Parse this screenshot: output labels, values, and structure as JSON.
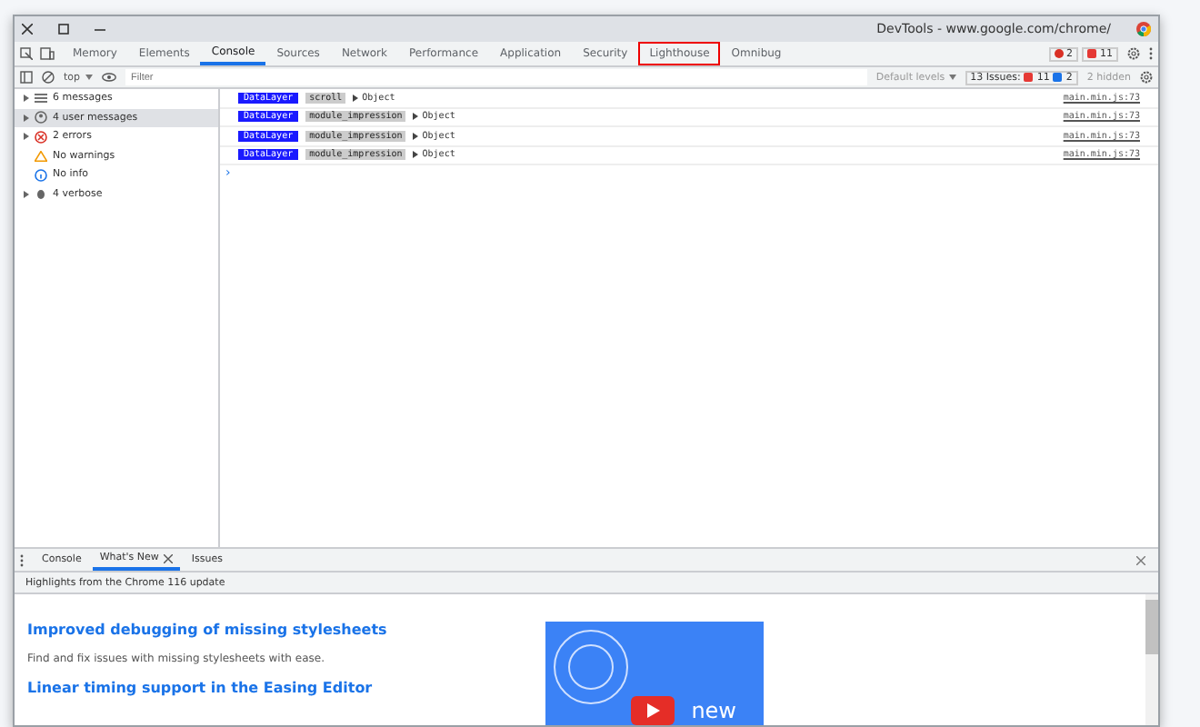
{
  "window": {
    "title": "DevTools - www.google.com/chrome/"
  },
  "tabs": [
    {
      "label": "Memory",
      "selected": false,
      "highlighted": false
    },
    {
      "label": "Elements",
      "selected": false,
      "highlighted": false
    },
    {
      "label": "Console",
      "selected": true,
      "highlighted": false
    },
    {
      "label": "Sources",
      "selected": false,
      "highlighted": false
    },
    {
      "label": "Network",
      "selected": false,
      "highlighted": false
    },
    {
      "label": "Performance",
      "selected": false,
      "highlighted": false
    },
    {
      "label": "Application",
      "selected": false,
      "highlighted": false
    },
    {
      "label": "Security",
      "selected": false,
      "highlighted": false
    },
    {
      "label": "Lighthouse",
      "selected": false,
      "highlighted": true
    },
    {
      "label": "Omnibug",
      "selected": false,
      "highlighted": false
    }
  ],
  "tab_badges": {
    "errors": "2",
    "issues": "11"
  },
  "toolbar": {
    "context": "top",
    "filter_placeholder": "Filter",
    "levels": "Default levels",
    "issues_label": "13 Issues:",
    "issues_errors": "11",
    "issues_info": "2",
    "hidden": "2 hidden"
  },
  "sidebar": {
    "items": [
      {
        "kind": "list",
        "label": "6 messages",
        "expandable": true,
        "selected": false
      },
      {
        "kind": "user",
        "label": "4 user messages",
        "expandable": true,
        "selected": true
      },
      {
        "kind": "error",
        "label": "2 errors",
        "expandable": true,
        "selected": false
      },
      {
        "kind": "warning",
        "label": "No warnings",
        "expandable": false,
        "selected": false
      },
      {
        "kind": "info",
        "label": "No info",
        "expandable": false,
        "selected": false
      },
      {
        "kind": "verbose",
        "label": "4 verbose",
        "expandable": true,
        "selected": false
      }
    ]
  },
  "console": {
    "messages": [
      {
        "tag": "DataLayer",
        "event": "scroll",
        "value": "Object",
        "source": "main.min.js:73"
      },
      {
        "tag": "DataLayer",
        "event": "module_impression",
        "value": "Object",
        "source": "main.min.js:73"
      },
      {
        "tag": "DataLayer",
        "event": "module_impression",
        "value": "Object",
        "source": "main.min.js:73"
      },
      {
        "tag": "DataLayer",
        "event": "module_impression",
        "value": "Object",
        "source": "main.min.js:73"
      }
    ],
    "prompt": "›"
  },
  "drawer": {
    "tabs": [
      {
        "label": "Console",
        "selected": false,
        "closable": false
      },
      {
        "label": "What's New",
        "selected": true,
        "closable": true
      },
      {
        "label": "Issues",
        "selected": false,
        "closable": false
      }
    ],
    "subtitle": "Highlights from the Chrome 116 update",
    "articles": [
      {
        "title": "Improved debugging of missing stylesheets",
        "text": "Find and fix issues with missing stylesheets with ease."
      },
      {
        "title": "Linear timing support in the Easing Editor"
      }
    ],
    "video_label": "new"
  }
}
